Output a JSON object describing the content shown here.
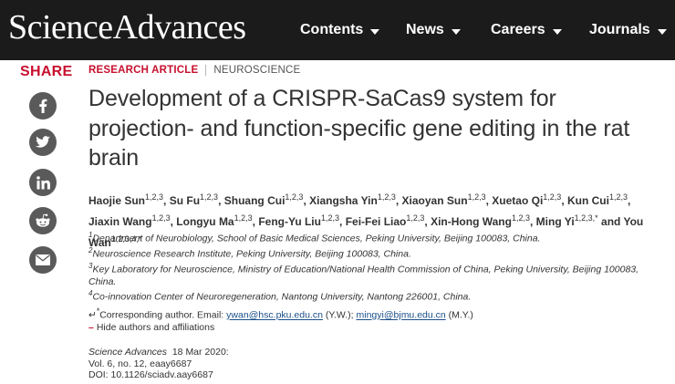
{
  "header": {
    "logo": "ScienceAdvances",
    "nav": [
      {
        "label": "Contents"
      },
      {
        "label": "News"
      },
      {
        "label": "Careers"
      },
      {
        "label": "Journals"
      }
    ]
  },
  "share": {
    "label": "SHARE",
    "buttons": [
      {
        "icon": "facebook-icon"
      },
      {
        "icon": "twitter-icon"
      },
      {
        "icon": "linkedin-icon"
      },
      {
        "icon": "reddit-icon"
      },
      {
        "icon": "email-icon"
      }
    ]
  },
  "article": {
    "type": "RESEARCH ARTICLE",
    "subject": "NEUROSCIENCE",
    "title": "Development of a CRISPR-SaCas9 system for projection- and function-specific gene editing in the rat brain",
    "authors": [
      {
        "name": "Haojie Sun",
        "aff": "1,2,3"
      },
      {
        "name": "Su Fu",
        "aff": "1,2,3"
      },
      {
        "name": "Shuang Cui",
        "aff": "1,2,3"
      },
      {
        "name": "Xiangsha Yin",
        "aff": "1,2,3"
      },
      {
        "name": "Xiaoyan Sun",
        "aff": "1,2,3"
      },
      {
        "name": "Xuetao Qi",
        "aff": "1,2,3"
      },
      {
        "name": "Kun Cui",
        "aff": "1,2,3"
      },
      {
        "name": "Jiaxin Wang",
        "aff": "1,2,3"
      },
      {
        "name": "Longyu Ma",
        "aff": "1,2,3"
      },
      {
        "name": "Feng-Yu Liu",
        "aff": "1,2,3"
      },
      {
        "name": "Fei-Fei Liao",
        "aff": "1,2,3"
      },
      {
        "name": "Xin-Hong Wang",
        "aff": "1,2,3"
      },
      {
        "name": "Ming Yi",
        "aff": "1,2,3,*"
      },
      {
        "name": "You Wan",
        "aff": "1,2,3,4,*"
      }
    ],
    "affiliations": [
      {
        "num": "1",
        "text": "Department of Neurobiology, School of Basic Medical Sciences, Peking University, Beijing 100083, China."
      },
      {
        "num": "2",
        "text": "Neuroscience Research Institute, Peking University, Beijing 100083, China."
      },
      {
        "num": "3",
        "text": "Key Laboratory for Neuroscience, Ministry of Education/National Health Commission of China, Peking University, Beijing 100083, China."
      },
      {
        "num": "4",
        "text": "Co-innovation Center of Neuroregeneration, Nantong University, Nantong 226001, China."
      }
    ],
    "corresponding": {
      "marker": "*",
      "prefix": "Corresponding author. Email: ",
      "email1": "ywan@hsc.pku.edu.cn",
      "note1": " (Y.W.); ",
      "email2": "mingyi@bjmu.edu.cn",
      "note2": " (M.Y.)"
    },
    "hide_authors": "Hide authors and affiliations",
    "citation": {
      "journal": "Science Advances",
      "date": "18 Mar 2020:",
      "volume": "Vol. 6, no. 12, eaay6687",
      "doi": "DOI: 10.1126/sciadv.aay6687"
    }
  }
}
